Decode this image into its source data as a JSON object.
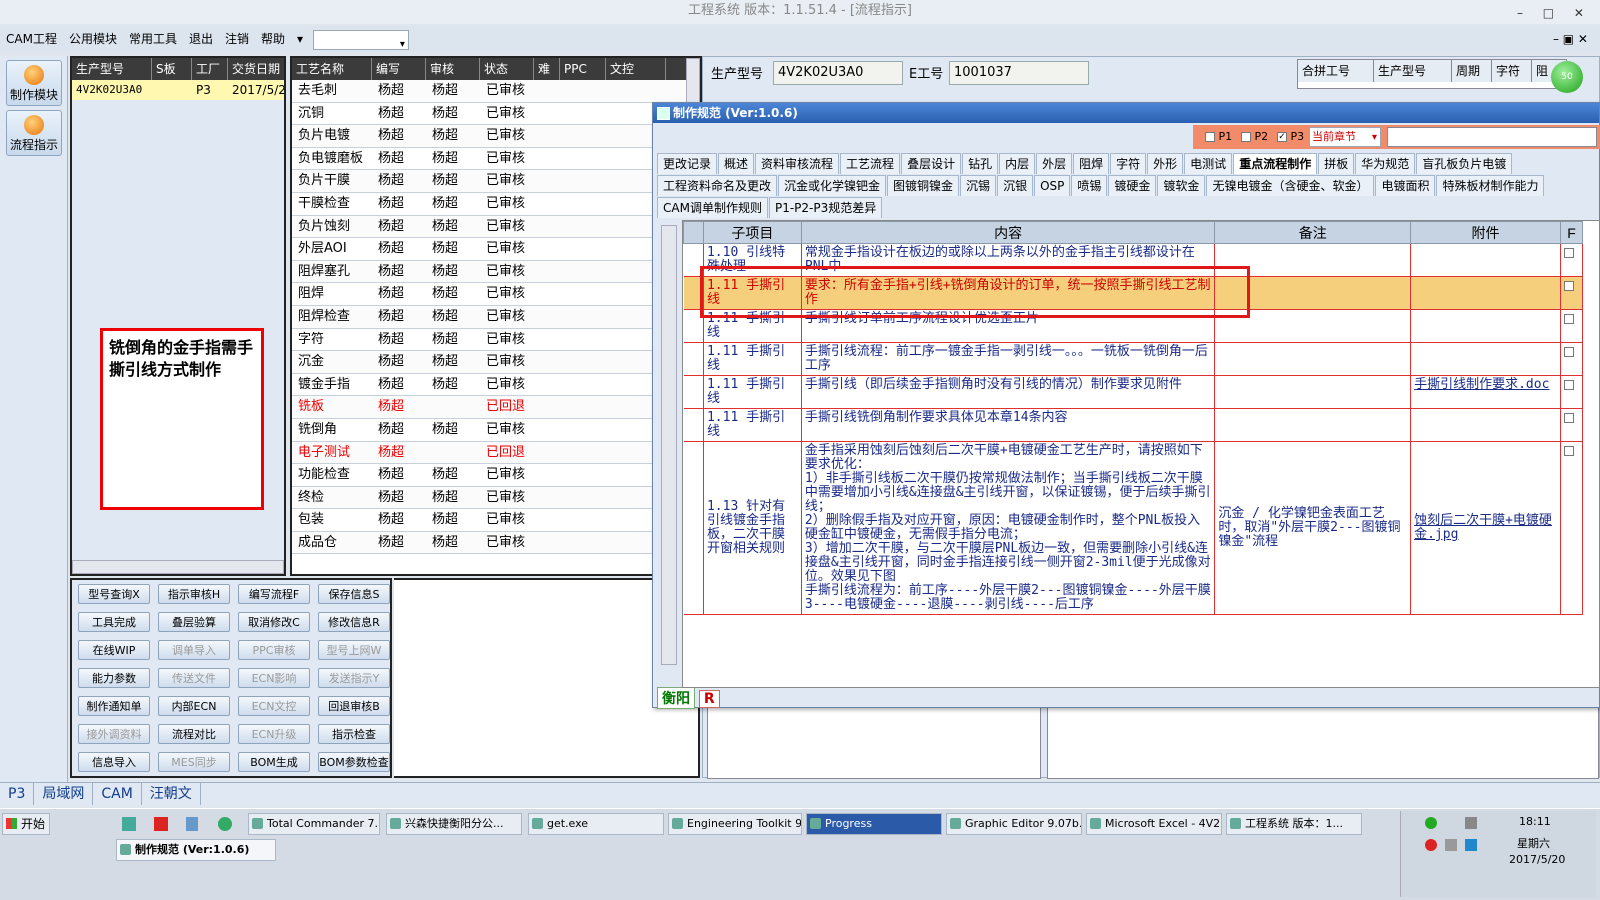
{
  "window": {
    "title": "工程系统    版本：1.1.51.4 - [流程指示]"
  },
  "menu": [
    "CAM工程",
    "公用模块",
    "常用工具",
    "退出",
    "注销",
    "帮助"
  ],
  "sidebar": [
    {
      "label": "制作模块"
    },
    {
      "label": "流程指示"
    }
  ],
  "orders": {
    "headers": [
      "生产型号",
      "S板",
      "工厂",
      "交货日期"
    ],
    "row": [
      "4V2K02U3A0",
      "",
      "P3",
      "2017/5/2"
    ]
  },
  "process": {
    "headers": [
      "工艺名称",
      "编写",
      "审核",
      "状态",
      "难",
      "PPC",
      "文控"
    ],
    "rows": [
      {
        "name": "去毛刺",
        "writer": "杨超",
        "reviewer": "杨超",
        "status": "已审核",
        "red": false
      },
      {
        "name": "沉铜",
        "writer": "杨超",
        "reviewer": "杨超",
        "status": "已审核",
        "red": false
      },
      {
        "name": "负片电镀",
        "writer": "杨超",
        "reviewer": "杨超",
        "status": "已审核",
        "red": false
      },
      {
        "name": "负电镀磨板",
        "writer": "杨超",
        "reviewer": "杨超",
        "status": "已审核",
        "red": false
      },
      {
        "name": "负片干膜",
        "writer": "杨超",
        "reviewer": "杨超",
        "status": "已审核",
        "red": false
      },
      {
        "name": "干膜检查",
        "writer": "杨超",
        "reviewer": "杨超",
        "status": "已审核",
        "red": false
      },
      {
        "name": "负片蚀刻",
        "writer": "杨超",
        "reviewer": "杨超",
        "status": "已审核",
        "red": false
      },
      {
        "name": "外层AOI",
        "writer": "杨超",
        "reviewer": "杨超",
        "status": "已审核",
        "red": false
      },
      {
        "name": "阻焊塞孔",
        "writer": "杨超",
        "reviewer": "杨超",
        "status": "已审核",
        "red": false
      },
      {
        "name": "阻焊",
        "writer": "杨超",
        "reviewer": "杨超",
        "status": "已审核",
        "red": false
      },
      {
        "name": "阻焊检查",
        "writer": "杨超",
        "reviewer": "杨超",
        "status": "已审核",
        "red": false
      },
      {
        "name": "字符",
        "writer": "杨超",
        "reviewer": "杨超",
        "status": "已审核",
        "red": false
      },
      {
        "name": "沉金",
        "writer": "杨超",
        "reviewer": "杨超",
        "status": "已审核",
        "red": false
      },
      {
        "name": "镀金手指",
        "writer": "杨超",
        "reviewer": "杨超",
        "status": "已审核",
        "red": false
      },
      {
        "name": "铣板",
        "writer": "杨超",
        "reviewer": "",
        "status": "已回退",
        "red": true
      },
      {
        "name": "铣倒角",
        "writer": "杨超",
        "reviewer": "杨超",
        "status": "已审核",
        "red": false
      },
      {
        "name": "电子测试",
        "writer": "杨超",
        "reviewer": "",
        "status": "已回退",
        "red": true
      },
      {
        "name": "功能检查",
        "writer": "杨超",
        "reviewer": "杨超",
        "status": "已审核",
        "red": false
      },
      {
        "name": "终检",
        "writer": "杨超",
        "reviewer": "杨超",
        "status": "已审核",
        "red": false
      },
      {
        "name": "包装",
        "writer": "杨超",
        "reviewer": "杨超",
        "status": "已审核",
        "red": false
      },
      {
        "name": "成品仓",
        "writer": "杨超",
        "reviewer": "杨超",
        "status": "已审核",
        "red": false
      }
    ]
  },
  "note": {
    "text": "铣倒角的金手指需手撕引线方式制作"
  },
  "buttons": [
    {
      "label": "型号查询X",
      "disabled": false
    },
    {
      "label": "指示审核H",
      "disabled": false
    },
    {
      "label": "编写流程F",
      "disabled": false
    },
    {
      "label": "保存信息S",
      "disabled": false
    },
    {
      "label": "工具完成",
      "disabled": false
    },
    {
      "label": "叠层验算",
      "disabled": false
    },
    {
      "label": "取消修改C",
      "disabled": false
    },
    {
      "label": "修改信息R",
      "disabled": false
    },
    {
      "label": "在线WIP",
      "disabled": false
    },
    {
      "label": "调单导入",
      "disabled": true
    },
    {
      "label": "PPC审核",
      "disabled": true
    },
    {
      "label": "型号上网W",
      "disabled": true
    },
    {
      "label": "能力参数",
      "disabled": false
    },
    {
      "label": "传送文件",
      "disabled": true
    },
    {
      "label": "ECN影响",
      "disabled": true
    },
    {
      "label": "发送指示Y",
      "disabled": true
    },
    {
      "label": "制作通知单",
      "disabled": false
    },
    {
      "label": "内部ECN",
      "disabled": false
    },
    {
      "label": "ECN文控",
      "disabled": true
    },
    {
      "label": "回退审核B",
      "disabled": false
    },
    {
      "label": "接外调资料",
      "disabled": true
    },
    {
      "label": "流程对比",
      "disabled": false
    },
    {
      "label": "ECN升级",
      "disabled": true
    },
    {
      "label": "指示检查",
      "disabled": false
    },
    {
      "label": "信息导入",
      "disabled": false
    },
    {
      "label": "MES同步",
      "disabled": true
    },
    {
      "label": "BOM生成",
      "disabled": false
    },
    {
      "label": "BOM参数检查",
      "disabled": false
    }
  ],
  "info": {
    "model_label": "生产型号",
    "model_value": "4V2K02U3A0",
    "eno_label": "E工号",
    "eno_value": "1001037"
  },
  "merge_table": {
    "headers": [
      "合拼工号",
      "生产型号",
      "周期",
      "字符",
      "阻"
    ]
  },
  "dialog": {
    "title": "制作规范 (Ver:1.0.6)",
    "checks": [
      "P1",
      "P2",
      "P3"
    ],
    "chapter": "当前章节",
    "tabs_row1": [
      "更改记录",
      "概述",
      "资料审核流程",
      "工艺流程",
      "叠层设计",
      "钻孔",
      "内层",
      "外层",
      "阻焊",
      "字符",
      "外形",
      "电测试",
      "重点流程制作",
      "拼板",
      "华为规范",
      "盲孔板负片电镀"
    ],
    "tabs_row2": [
      "工程资料命名及更改",
      "沉金或化学镍钯金",
      "图镀铜镍金",
      "沉锡",
      "沉银",
      "OSP",
      "喷锡",
      "镀硬金",
      "镀软金",
      "无镍电镀金（含硬金、软金）",
      "电镀面积",
      "特殊板材制作能力"
    ],
    "tabs_row3": [
      "CAM调单制作规则",
      "P1-P2-P3规范差异"
    ],
    "columns": [
      "子项目",
      "内容",
      "备注",
      "附件",
      "F"
    ],
    "rows": [
      {
        "item": "1.10 引线特殊处理",
        "content": "常规金手指设计在板边的或除以上两条以外的金手指主引线都设计在PNL中",
        "remark": "",
        "attach": "",
        "hl": false
      },
      {
        "item": "1.11 手撕引线",
        "content": "要求：所有金手指+引线+铣倒角设计的订单，统一按照手撕引线工艺制作",
        "remark": "",
        "attach": "",
        "hl": true
      },
      {
        "item": "1.11 手撕引线",
        "content": "手撕引线订单前工序流程设计优选歪正片",
        "remark": "",
        "attach": "",
        "hl": false
      },
      {
        "item": "1.11 手撕引线",
        "content": "手撕引线流程：前工序一镀金手指一剥引线一。。。一铣板一铣倒角一后工序",
        "remark": "",
        "attach": "",
        "hl": false
      },
      {
        "item": "1.11 手撕引线",
        "content": "手撕引线（即后续金手指铡角时没有引线的情况）制作要求见附件",
        "remark": "",
        "attach": "手撕引线制作要求.doc",
        "hl": false
      },
      {
        "item": "1.11 手撕引线",
        "content": "手撕引线铣倒角制作要求具体见本章14条内容",
        "remark": "",
        "attach": "",
        "hl": false
      },
      {
        "item": "1.13 针对有引线镀金手指板，二次干膜开窗相关规则",
        "content": "金手指采用蚀刻后蚀刻后二次干膜+电镀硬金工艺生产时，请按照如下要求优化：\n1）非手撕引线板二次干膜仍按常规做法制作；当手撕引线板二次干膜中需要增加小引线&连接盘&主引线开窗，以保证镀锡，便于后续手撕引线；\n2）删除假手指及对应开窗，原因：电镀硬金制作时，整个PNL板投入硬金缸中镀硬金，无需假手指分电流；\n3）增加二次干膜，与二次干膜层PNL板边一致，但需要删除小引线&连接盘&主引线开窗，同时金手指连接引线一侧开窗2-3mil便于光成像对位。效果见下图\n手撕引线流程为：前工序----外层干膜2---图镀铜镍金----外层干膜3----电镀硬金----退膜----剥引线----后工序",
        "remark": "沉金 / 化学镍钯金表面工艺时，取消\"外层干膜2---图镀铜镍金\"流程",
        "attach": "蚀刻后二次干膜+电镀硬金.jpg",
        "hl": false
      }
    ],
    "footer": {
      "site": "衡阳",
      "badge": "R"
    }
  },
  "status": [
    "P3",
    "局域网",
    "CAM",
    "汪朝文"
  ],
  "taskbar": {
    "start": "开始",
    "items": [
      {
        "label": "Total Commander 7....",
        "active": false
      },
      {
        "label": "兴森快捷衡阳分公...",
        "active": false
      },
      {
        "label": "get.exe",
        "active": false
      },
      {
        "label": "Engineering Toolkit 9...",
        "active": false
      },
      {
        "label": "Progress",
        "active": true
      },
      {
        "label": "Graphic Editor 9.07b...",
        "active": false
      },
      {
        "label": "Microsoft Excel - 4V2...",
        "active": false
      },
      {
        "label": "工程系统   版本：1...",
        "active": false
      }
    ],
    "second_row": "制作规范 (Ver:1.0.6)",
    "time": "18:11",
    "weekday": "星期六",
    "date": "2017/5/20"
  },
  "badge_green": "50"
}
